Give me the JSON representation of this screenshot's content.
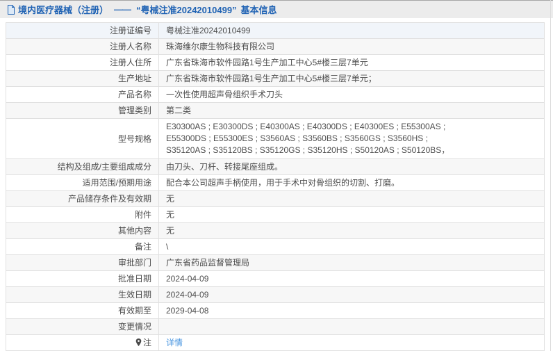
{
  "header": {
    "prefix": "境内医疗器械（注册）",
    "dash": "——",
    "reg_quoted": "“粤械注准20242010499”",
    "suffix": "基本信息"
  },
  "colors": {
    "header_text": "#2063b4",
    "link": "#4a96e0",
    "stripe_row": "#f7f7f7",
    "first_row": "#f1f5fa",
    "header_bar_bg": "#ececec"
  },
  "table": {
    "rows": [
      {
        "label": "注册证编号",
        "value": "粤械注准20242010499"
      },
      {
        "label": "注册人名称",
        "value": "珠海维尔康生物科技有限公司"
      },
      {
        "label": "注册人住所",
        "value": "广东省珠海市软件园路1号生产加工中心5#楼三层7单元"
      },
      {
        "label": "生产地址",
        "value": "广东省珠海市软件园路1号生产加工中心5#楼三层7单元；"
      },
      {
        "label": "产品名称",
        "value": "一次性使用超声骨组织手术刀头"
      },
      {
        "label": "管理类别",
        "value": "第二类"
      },
      {
        "label": "型号规格",
        "value_lines": [
          "E30300AS ; E30300DS ; E40300AS ; E40300DS ; E40300ES ; E55300AS ;",
          "E55300DS ; E55300ES ; S3560AS ; S3560BS ; S3560GS ; S3560HS ;",
          "S35120AS ; S35120BS ; S35120GS ; S35120HS ; S50120AS ; S50120BS，"
        ]
      },
      {
        "label": "结构及组成/主要组成成分",
        "value": "由刀头、刀杆、转接尾座组成。"
      },
      {
        "label": "适用范围/预期用途",
        "value": "配合本公司超声手柄使用，用于手术中对骨组织的切割、打磨。"
      },
      {
        "label": "产品储存条件及有效期",
        "value": "无"
      },
      {
        "label": "附件",
        "value": "无"
      },
      {
        "label": "其他内容",
        "value": "无"
      },
      {
        "label": "备注",
        "value": "\\"
      },
      {
        "label": "审批部门",
        "value": "广东省药品监督管理局"
      },
      {
        "label": "批准日期",
        "value": "2024-04-09"
      },
      {
        "label": "生效日期",
        "value": "2024-04-09"
      },
      {
        "label": "有效期至",
        "value": "2029-04-08"
      },
      {
        "label": "变更情况",
        "value": ""
      },
      {
        "label": "注",
        "value": "详情"
      }
    ]
  }
}
